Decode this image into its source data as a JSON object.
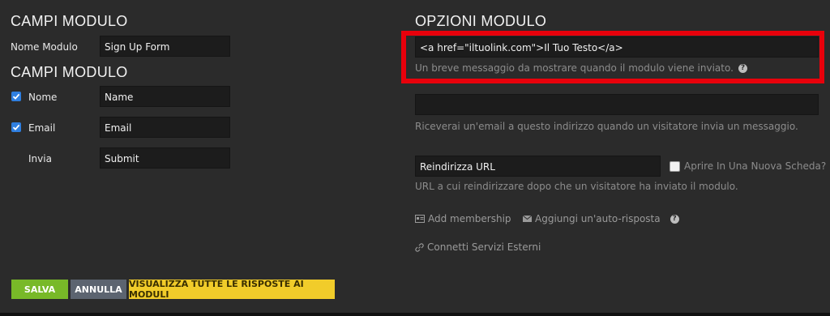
{
  "left": {
    "section1_title": "CAMPI MODULO",
    "form_name_label": "Nome Modulo",
    "form_name_value": "Sign Up Form",
    "section2_title": "CAMPI MODULO",
    "fields": [
      {
        "label": "Nome",
        "value": "Name",
        "checked": true
      },
      {
        "label": "Email",
        "value": "Email",
        "checked": true
      },
      {
        "label": "Invia",
        "value": "Submit",
        "checked": false
      }
    ]
  },
  "right": {
    "title": "OPZIONI MODULO",
    "success_message_value": "<a href=\"iltuolink.com\">Il Tuo Testo</a>",
    "success_message_help": "Un breve messaggio da mostrare quando il modulo viene inviato.",
    "email_value": "",
    "email_help": "Riceverai un'email a questo indirizzo quando un visitatore invia un messaggio.",
    "redirect_value": "Reindirizza URL",
    "new_tab_label": "Aprire In Una Nuova Scheda?",
    "redirect_help": "URL a cui reindirizzare dopo che un visitatore ha inviato il modulo.",
    "add_membership": "Add membership",
    "add_autoresponder": "Aggiungi un'auto-risposta",
    "connect_services": "Connetti Servizi Esterni"
  },
  "buttons": {
    "save": "SALVA",
    "cancel": "ANNULLA",
    "view_all": "VISUALIZZA TUTTE LE RISPOSTE AI MODULI"
  },
  "colors": {
    "highlight": "#e8000b",
    "save_bg": "#78b928",
    "cancel_bg": "#5c6470",
    "view_all_bg": "#f1cc2a"
  }
}
